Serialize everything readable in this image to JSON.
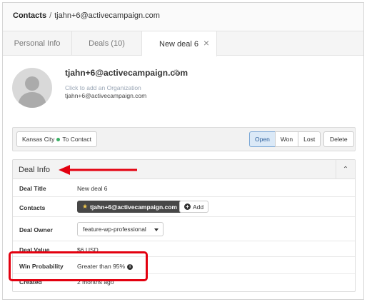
{
  "breadcrumb": {
    "root": "Contacts",
    "separator": "/",
    "current": "tjahn+6@activecampaign.com"
  },
  "tabs": [
    {
      "label": "Personal Info"
    },
    {
      "label": "Deals (10)"
    },
    {
      "label": "New deal 6"
    }
  ],
  "tab_close_glyph": "×",
  "contact": {
    "email": "tjahn+6@activecampaign.com",
    "gear_glyph": "⚙",
    "org_prompt": "Click to add an Organization",
    "email_sub": "tjahn+6@activecampaign.com"
  },
  "stage": {
    "pipeline": "Kansas City",
    "stage": "To Contact",
    "stage_dot_color": "#3ab065",
    "status_buttons": [
      "Open",
      "Won",
      "Lost"
    ],
    "active_status": "Open",
    "delete_label": "Delete"
  },
  "panel": {
    "title": "Deal Info",
    "collapse_glyph": "⌃",
    "rows": {
      "title": {
        "label": "Deal Title",
        "value": "New deal 6"
      },
      "contacts": {
        "label": "Contacts",
        "tag": "tjahn+6@activecampaign.com",
        "star": "★",
        "add_label": "Add",
        "add_glyph": "+"
      },
      "owner": {
        "label": "Deal Owner",
        "value": "feature-wp-professional"
      },
      "value": {
        "label": "Deal Value",
        "value": "$6 USD"
      },
      "probability": {
        "label": "Win Probability",
        "value": "Greater than 95%",
        "info_glyph": "i"
      },
      "created": {
        "label": "Created",
        "value": "2 months ago"
      }
    }
  },
  "annotation": {
    "color": "#e3000f"
  },
  "icons": {
    "avatar": "person-silhouette",
    "gear": "gear-icon",
    "close": "close-icon",
    "collapse": "chevron-up-icon",
    "star": "star-icon",
    "add": "plus-circle-icon",
    "info": "info-icon",
    "caret": "caret-down-icon"
  }
}
